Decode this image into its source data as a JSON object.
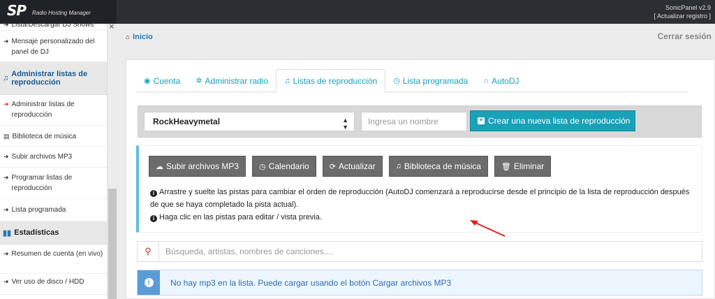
{
  "app": {
    "logo": "SP",
    "logo_sub": "Radio Hosting Manager",
    "version": "SonicPanel v2.9",
    "update_link": "[ Actualizar registro ]"
  },
  "sidebar": {
    "items": [
      {
        "label": "Lista/Descargar DJ Shows",
        "icon": "circle-arrow-icon"
      },
      {
        "label": "Mensaje personalizado del panel de DJ",
        "icon": "circle-arrow-icon"
      },
      {
        "section": "Administrar listas de reproducción",
        "icon": "music-icon"
      },
      {
        "label": "Administrar listas de reproducción",
        "icon": "circle-arrow-red-icon"
      },
      {
        "label": "Biblioteca de música",
        "icon": "book-icon"
      },
      {
        "label": "Subir archivos MP3",
        "icon": "circle-arrow-icon"
      },
      {
        "label": "Programar listas de reproducción",
        "icon": "circle-arrow-icon"
      },
      {
        "label": "Lista programada",
        "icon": "circle-arrow-icon"
      },
      {
        "section": "Estadísticas",
        "icon": "bar-chart-icon"
      },
      {
        "label": "Resumen de cuenta (en vivo)",
        "icon": "circle-arrow-icon"
      },
      {
        "label": "Ver uso de disco / HDD",
        "icon": "circle-arrow-icon"
      }
    ],
    "close": "×"
  },
  "header": {
    "breadcrumb_home": "Inicio",
    "logout": "Cerrar sesión"
  },
  "tabs": [
    {
      "label": "Cuenta",
      "icon": "user-circle-icon"
    },
    {
      "label": "Administrar radio",
      "icon": "gear-icon"
    },
    {
      "label": "Listas de reproducción",
      "icon": "music-icon",
      "active": true
    },
    {
      "label": "Lista programada",
      "icon": "clock-icon"
    },
    {
      "label": "AutoDJ",
      "icon": "headphones-icon"
    }
  ],
  "playlist": {
    "selected": "RockHeavymetal",
    "name_placeholder": "Ingresa un nombre",
    "create_label": "Crear una nueva lista de reproducción"
  },
  "tools": {
    "upload": "Subir archivos MP3",
    "calendar": "Calendario",
    "refresh": "Actualizar",
    "library": "Biblioteca de música",
    "delete": "Eliminar"
  },
  "info": {
    "line1": "Arrastre y suelte las pistas para cambiar el orden de reproducción (AutoDJ comenzará a reproducirse desde el principio de la lista de reproducción después de que se haya completado la pista actual).",
    "line2": "Haga clic en las pistas para editar / vista previa."
  },
  "search": {
    "placeholder": "Búsqueda, artistas, nombres de canciones...."
  },
  "alert": {
    "text": "No hay mp3 en la lista. Puede cargar usando el botón Cargar archivos MP3"
  },
  "colors": {
    "accent": "#17a2b8",
    "topbar": "#2b2e33",
    "tool_button": "#6c6c6c",
    "alert_blue": "#5b9bd8"
  }
}
